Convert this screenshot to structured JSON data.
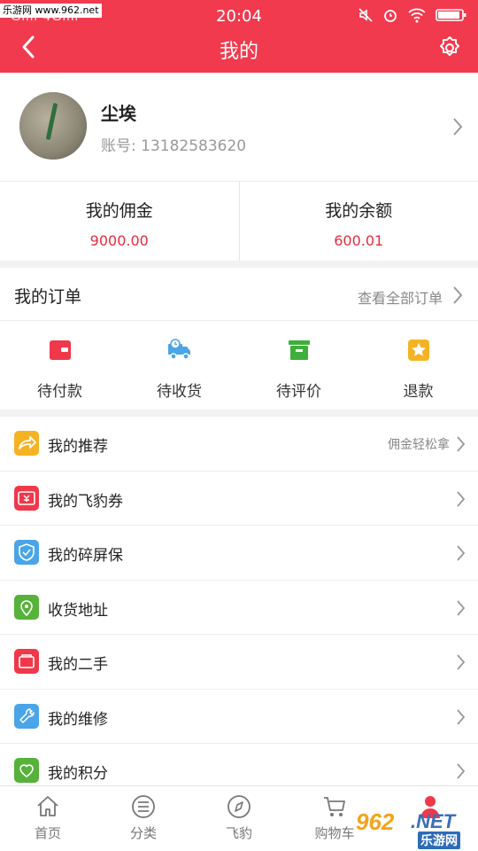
{
  "status_bar": {
    "watermark": "乐游网 www.962.net",
    "signal": "Gıııı 4Gıııı",
    "time": "20:04"
  },
  "header": {
    "title": "我的",
    "background": "#f23a4e"
  },
  "profile": {
    "name": "尘埃",
    "account": "账号: 13182583620"
  },
  "finance": [
    {
      "label": "我的佣金",
      "value": "9000.00"
    },
    {
      "label": "我的余额",
      "value": "600.01"
    }
  ],
  "orders": {
    "title": "我的订单",
    "view_all": "查看全部订单",
    "tabs": [
      {
        "label": "待付款",
        "icon": "wallet-icon",
        "color": "#f0384b"
      },
      {
        "label": "待收货",
        "icon": "truck-icon",
        "color": "#4aa4e8"
      },
      {
        "label": "待评价",
        "icon": "box-icon",
        "color": "#3fae3c"
      },
      {
        "label": "退款",
        "icon": "star-icon",
        "color": "#f5b324"
      }
    ]
  },
  "menu": [
    {
      "label": "我的推荐",
      "hint": "佣金轻松拿",
      "icon": "share-icon",
      "color": "#f5b324"
    },
    {
      "label": "我的飞豹券",
      "hint": "",
      "icon": "coupon-icon",
      "color": "#f0384b"
    },
    {
      "label": "我的碎屏保",
      "hint": "",
      "icon": "shield-icon",
      "color": "#4aa4e8"
    },
    {
      "label": "收货地址",
      "hint": "",
      "icon": "location-icon",
      "color": "#56b23a"
    },
    {
      "label": "我的二手",
      "hint": "",
      "icon": "folder-icon",
      "color": "#f0384b"
    },
    {
      "label": "我的维修",
      "hint": "",
      "icon": "wrench-icon",
      "color": "#4aa4e8"
    },
    {
      "label": "我的积分",
      "hint": "",
      "icon": "heart-icon",
      "color": "#56b23a"
    }
  ],
  "tabbar": [
    {
      "label": "首页",
      "icon": "home-icon"
    },
    {
      "label": "分类",
      "icon": "list-icon"
    },
    {
      "label": "飞豹",
      "icon": "compass-icon"
    },
    {
      "label": "购物车",
      "icon": "cart-icon"
    },
    {
      "label": "",
      "icon": "person-icon"
    }
  ],
  "watermark_logo": {
    "brand": "962",
    "suffix": ".NET",
    "site": "乐游网"
  }
}
